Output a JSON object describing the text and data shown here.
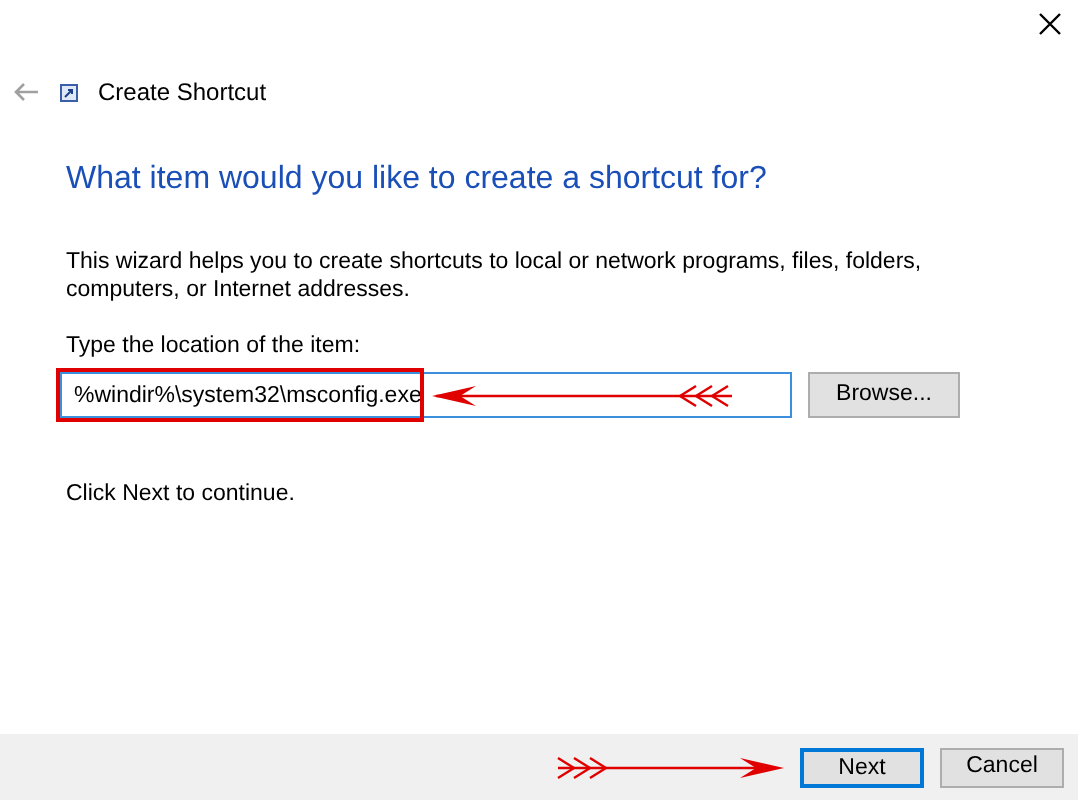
{
  "window": {
    "title": "Create Shortcut",
    "back_disabled": true
  },
  "heading": "What item would you like to create a shortcut for?",
  "description": "This wizard helps you to create shortcuts to local or network programs, files, folders, computers, or Internet addresses.",
  "location": {
    "label": "Type the location of the item:",
    "value": "%windir%\\system32\\msconfig.exe",
    "browse": "Browse..."
  },
  "hint": "Click Next to continue.",
  "buttons": [
    {
      "label": "Next",
      "default": true
    },
    {
      "label": "Cancel",
      "default": false
    }
  ]
}
